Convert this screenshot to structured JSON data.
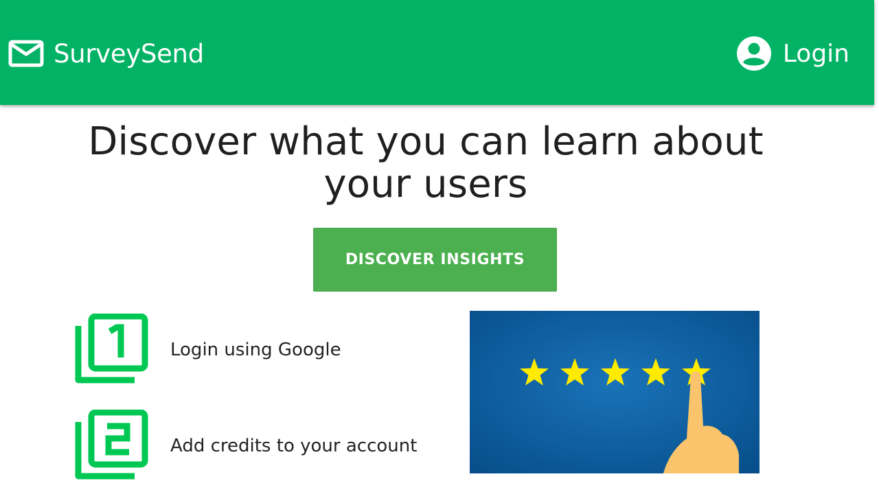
{
  "header": {
    "brand": "SurveySend",
    "login_label": "Login"
  },
  "hero": {
    "headline_line1": "Discover what you can learn about",
    "headline_line2": "your users",
    "cta_label": "DISCOVER INSIGHTS"
  },
  "steps": [
    {
      "number": "1",
      "text": "Login using Google"
    },
    {
      "number": "2",
      "text": "Add credits to your account"
    }
  ],
  "illustration": {
    "stars_count": 5,
    "rating": 5
  },
  "colors": {
    "header_bg": "#02b265",
    "cta_bg": "#4caf50",
    "step_icon": "#00c853",
    "illustration_bg": "#0a5c9a",
    "star": "#ffeb00",
    "hand": "#f9c46b"
  },
  "icons": {
    "brand": "mail-icon",
    "login": "account-circle-icon",
    "step_1": "filter-1-icon",
    "step_2": "filter-2-icon"
  }
}
